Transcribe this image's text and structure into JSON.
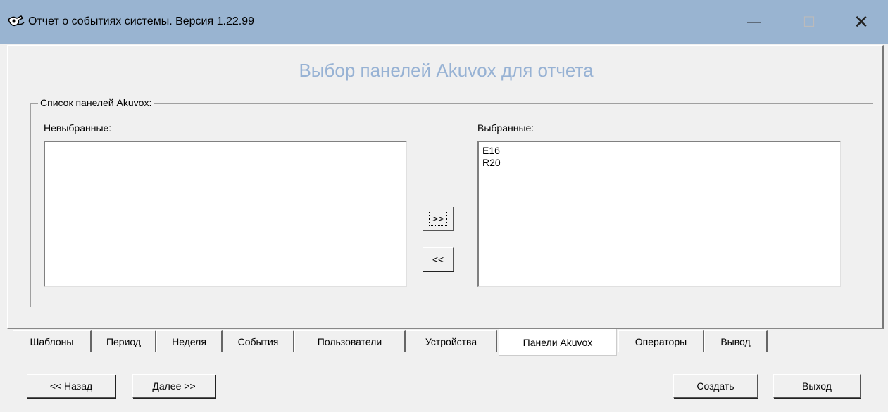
{
  "window": {
    "title": "Отчет о событиях системы.  Версия 1.22.99",
    "minimize": "—",
    "maximize": "☐",
    "close": "✕"
  },
  "page": {
    "heading": "Выбор панелей Akuvox для отчета",
    "group_label": "Список панелей Akuvox:",
    "unselected_label": "Невыбранные:",
    "selected_label": "Выбранные:",
    "unselected_items": [],
    "selected_items": [
      "E16",
      "R20"
    ],
    "add_button": ">>",
    "remove_button": "<<"
  },
  "tabs": [
    {
      "label": "Шаблоны"
    },
    {
      "label": "Период"
    },
    {
      "label": "Неделя"
    },
    {
      "label": "События"
    },
    {
      "label": "Пользователи"
    },
    {
      "label": "Устройства"
    },
    {
      "label": "Панели Akuvox",
      "active": true
    },
    {
      "label": "Операторы"
    },
    {
      "label": "Вывод"
    }
  ],
  "footer": {
    "back": "<< Назад",
    "next": "Далее >>",
    "create": "Создать",
    "exit": "Выход"
  },
  "icons": {
    "app": "eye-icon"
  }
}
